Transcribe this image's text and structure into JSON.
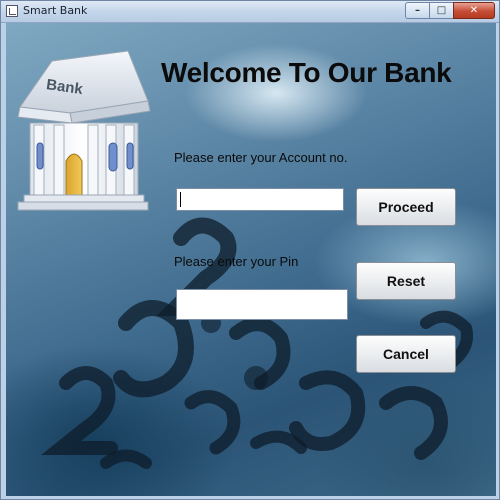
{
  "window": {
    "title": "Smart Bank",
    "minimize": "–",
    "maximize": "□",
    "close": "✕"
  },
  "logo": {
    "sign_text": "Bank"
  },
  "heading": "Welcome To Our Bank",
  "account": {
    "label": "Please enter your Account no.",
    "value": ""
  },
  "pin": {
    "label": "Please enter your Pin",
    "value": ""
  },
  "buttons": {
    "proceed": "Proceed",
    "reset": "Reset",
    "cancel": "Cancel"
  }
}
